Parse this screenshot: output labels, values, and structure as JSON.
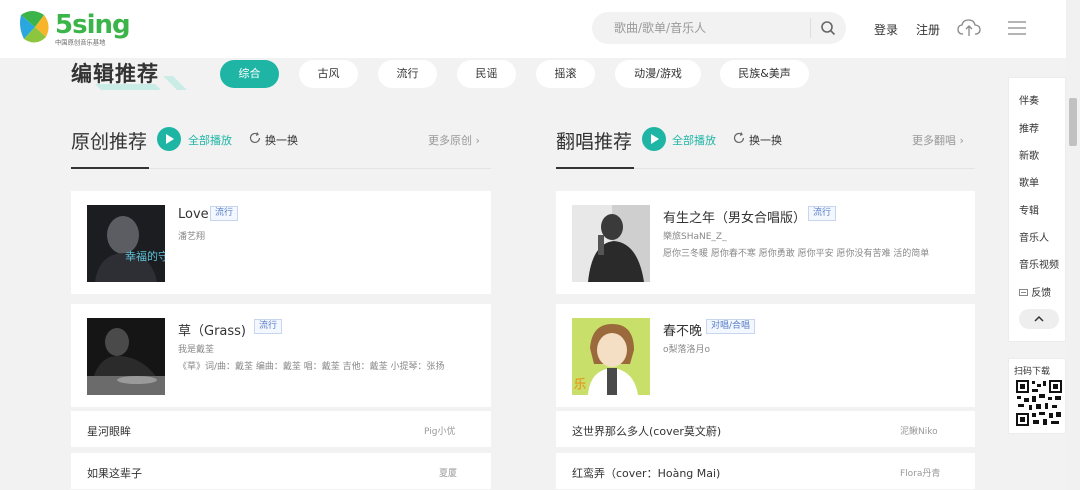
{
  "header": {
    "logo_text": "5sing",
    "logo_sub": "中国原创音乐基地",
    "search_placeholder": "歌曲/歌单/音乐人",
    "login": "登录",
    "register": "注册"
  },
  "editor": {
    "title": "编辑推荐",
    "tags": [
      "综合",
      "古风",
      "流行",
      "民谣",
      "摇滚",
      "动漫/游戏",
      "民族&美声"
    ],
    "active_tag": "综合",
    "accent": "#1fb5a5"
  },
  "original": {
    "title": "原创推荐",
    "play_all": "全部播放",
    "refresh": "换一换",
    "more": "更多原创",
    "cards": [
      {
        "title": "Love",
        "tag": "流行",
        "artist": "潘艺翔",
        "desc": "",
        "cover_text": "幸福的守候"
      },
      {
        "title": "草（Grass)",
        "tag": "流行",
        "artist": "我是戴荃",
        "desc": "《草》词/曲：戴荃 编曲：戴荃 唱：戴荃 吉他：戴荃 小提琴：张扬",
        "cover_text": ""
      }
    ],
    "rows": [
      {
        "title": "星河眼眸",
        "artist": "Pig小优"
      },
      {
        "title": "如果这辈子",
        "artist": "夏厦"
      }
    ]
  },
  "cover": {
    "title": "翻唱推荐",
    "play_all": "全部播放",
    "refresh": "换一换",
    "more": "更多翻唱",
    "cards": [
      {
        "title": "有生之年（男女合唱版）",
        "tag": "流行",
        "artist": "樂旅SHaNE_Z_",
        "desc": "愿你三冬暖 愿你春不寒 愿你勇敢 愿你平安 愿你没有苦难 活的简单",
        "cover_text": ""
      },
      {
        "title": "春不晚",
        "tag": "对唱/合唱",
        "artist": "o梨落洛月o",
        "desc": "",
        "cover_text": "乐"
      }
    ],
    "rows": [
      {
        "title": "这世界那么多人(cover莫文蔚)",
        "artist": "泥鳅Niko"
      },
      {
        "title": "红鸾弄（cover：Hoàng Mai)",
        "artist": "Flora丹青"
      }
    ]
  },
  "float_nav": {
    "items": [
      "伴奏",
      "推荐",
      "新歌",
      "歌单",
      "专辑",
      "音乐人",
      "音乐视频",
      "反馈"
    ],
    "qr_label": "扫码下载"
  }
}
